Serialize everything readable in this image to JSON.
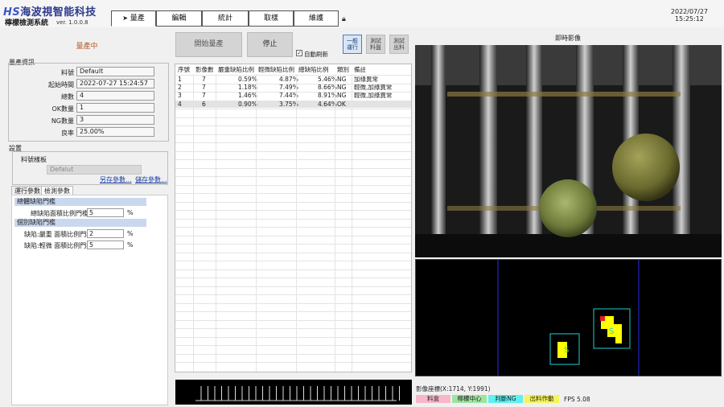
{
  "header": {
    "logo_mark": "HS",
    "company": "海波視智能科技",
    "system_name": "檸檬檢測系統",
    "version": "ver. 1.0.0.8",
    "tabs": [
      {
        "label": "量產",
        "active": true
      },
      {
        "label": "編輯"
      },
      {
        "label": "統計"
      },
      {
        "label": "取樣"
      },
      {
        "label": "維護"
      }
    ],
    "date": "2022/07/27",
    "time": "15:25:12"
  },
  "left": {
    "status": "量產中",
    "info_title": "量產資訊",
    "fields": [
      {
        "label": "料號",
        "value": "Default"
      },
      {
        "label": "起始時間",
        "value": "2022-07-27 15:24:57"
      },
      {
        "label": "總數",
        "value": "4"
      },
      {
        "label": "OK數量",
        "value": "1"
      },
      {
        "label": "NG數量",
        "value": "3"
      },
      {
        "label": "良率",
        "value": "25.00%"
      }
    ],
    "settings_title": "設置",
    "template_label": "料號樣板",
    "template_value": "Defalut",
    "save_as": "另存參數...",
    "save": "儲存參數...",
    "subtabs": [
      {
        "label": "運行參數"
      },
      {
        "label": "檢測參數",
        "active": true
      }
    ],
    "group1_title": "總體缺陷門檻",
    "total_defect_label": "總缺陷面積比例門檻",
    "total_defect_value": "5",
    "group2_title": "個別缺陷門檻",
    "severe_label": "缺陷:嚴重 面積比例門檻",
    "severe_value": "2",
    "light_label": "缺陷:輕微 面積比例門檻",
    "light_value": "5",
    "unit": "%"
  },
  "controls": {
    "start": "開始量產",
    "stop": "停止",
    "auto_refresh": "自動刷新",
    "auto_refresh_checked": true,
    "mode_buttons": [
      "一般\n運行",
      "測試\n料盤",
      "測試\n出料"
    ]
  },
  "table": {
    "headers": [
      "序號",
      "影像數",
      "嚴重缺陷比例",
      "輕微缺陷比例",
      "總缺陷比例",
      "類別",
      "備註"
    ],
    "rows": [
      [
        "1",
        "7",
        "0.59%",
        "4.87%",
        "5.46%",
        "NG",
        "加綠異常"
      ],
      [
        "2",
        "7",
        "1.18%",
        "7.49%",
        "8.66%",
        "NG",
        "輕微,加綠異常"
      ],
      [
        "3",
        "7",
        "1.46%",
        "7.44%",
        "8.91%",
        "NG",
        "輕微,加綠異常"
      ],
      [
        "4",
        "6",
        "0.90%",
        "3.75%",
        "4.64%",
        "OK",
        ""
      ]
    ]
  },
  "right": {
    "camera_title": "即時影像",
    "coords": "影像座標(X:1714, Y:1991)",
    "legend": [
      {
        "label": "料盒",
        "color": "#f7b7c8"
      },
      {
        "label": "檸檬中心",
        "color": "#9fe39f"
      },
      {
        "label": "判斷NG",
        "color": "#5ff0f0"
      },
      {
        "label": "出料作動",
        "color": "#f5f55a"
      }
    ],
    "fps": "FPS 5.08"
  }
}
